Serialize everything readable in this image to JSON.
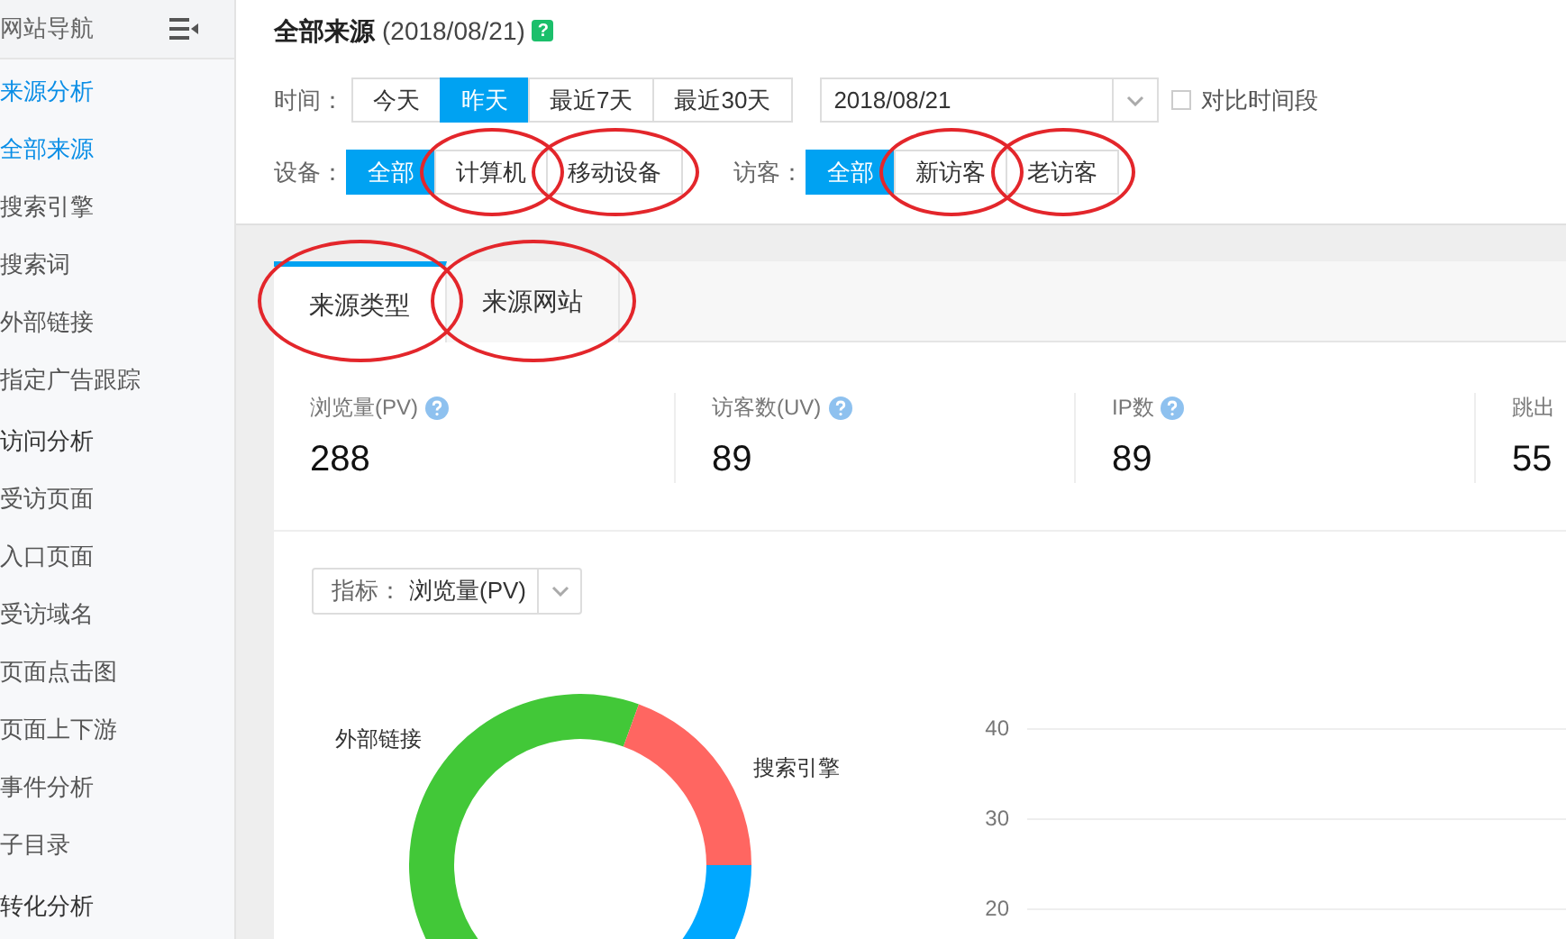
{
  "sidebar": {
    "title": "网站导航",
    "sections": [
      {
        "label": "来源分析",
        "selected": true,
        "items": [
          {
            "label": "全部来源",
            "selected": true
          },
          {
            "label": "搜索引擎",
            "selected": false
          },
          {
            "label": "搜索词",
            "selected": false
          },
          {
            "label": "外部链接",
            "selected": false
          },
          {
            "label": "指定广告跟踪",
            "selected": false
          }
        ]
      },
      {
        "label": "访问分析",
        "selected": false,
        "items": [
          {
            "label": "受访页面",
            "selected": false
          },
          {
            "label": "入口页面",
            "selected": false
          },
          {
            "label": "受访域名",
            "selected": false
          },
          {
            "label": "页面点击图",
            "selected": false
          },
          {
            "label": "页面上下游",
            "selected": false
          },
          {
            "label": "事件分析",
            "selected": false
          },
          {
            "label": "子目录",
            "selected": false
          }
        ]
      },
      {
        "label": "转化分析",
        "selected": false
      }
    ]
  },
  "header": {
    "title": "全部来源",
    "date": "(2018/08/21)",
    "help": "?"
  },
  "filters": {
    "time_label": "时间：",
    "time_options": [
      {
        "label": "今天",
        "selected": false
      },
      {
        "label": "昨天",
        "selected": true
      },
      {
        "label": "最近7天",
        "selected": false
      },
      {
        "label": "最近30天",
        "selected": false
      }
    ],
    "date_value": "2018/08/21",
    "compare": {
      "label": "对比时间段",
      "checked": false
    },
    "device_label": "设备：",
    "device_options": [
      {
        "label": "全部",
        "selected": true,
        "circled": false
      },
      {
        "label": "计算机",
        "selected": false,
        "circled": true
      },
      {
        "label": "移动设备",
        "selected": false,
        "circled": true
      }
    ],
    "visitor_label": "访客：",
    "visitor_options": [
      {
        "label": "全部",
        "selected": true,
        "circled": false
      },
      {
        "label": "新访客",
        "selected": false,
        "circled": true
      },
      {
        "label": "老访客",
        "selected": false,
        "circled": true
      }
    ]
  },
  "tabs": [
    {
      "label": "来源类型",
      "selected": true,
      "circled": true
    },
    {
      "label": "来源网站",
      "selected": false,
      "circled": true
    }
  ],
  "metrics": [
    {
      "label": "浏览量(PV)",
      "value": "288",
      "help": true
    },
    {
      "label": "访客数(UV)",
      "value": "89",
      "help": true
    },
    {
      "label": "IP数",
      "value": "89",
      "help": true
    },
    {
      "label": "跳出",
      "value": "55",
      "help": false
    }
  ],
  "indicator": {
    "label": "指标：",
    "value": "浏览量(PV)"
  },
  "donut_labels": [
    "外部链接",
    "搜索引擎"
  ],
  "axis_ticks": [
    "40",
    "30",
    "20"
  ]
}
